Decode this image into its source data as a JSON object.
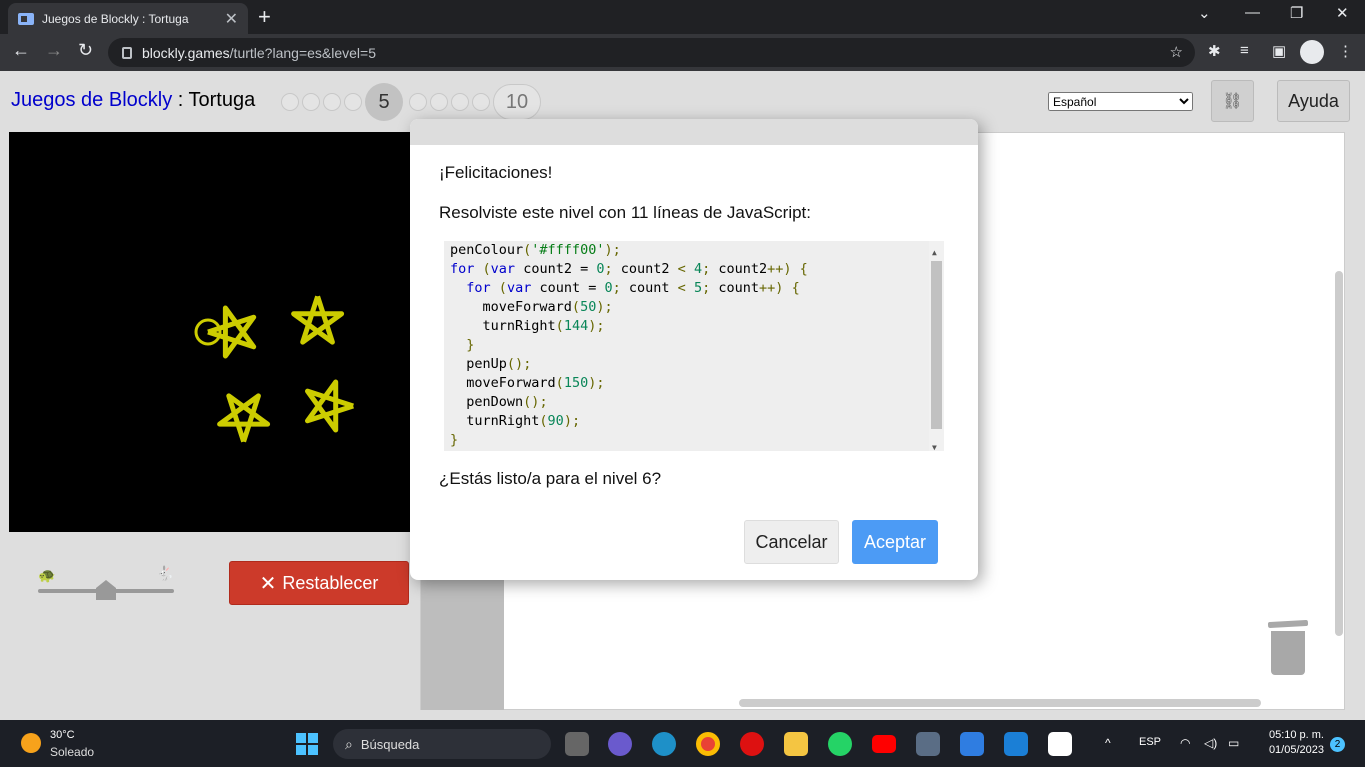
{
  "browser": {
    "tab_title": "Juegos de Blockly : Tortuga",
    "tab_close": "✕",
    "new_tab": "+",
    "url_host": "blockly.games",
    "url_path": "/turtle?lang=es&level=5"
  },
  "header": {
    "app_link": "Juegos de Blockly",
    "separator": " : ",
    "page": "Tortuga",
    "current_level": "5",
    "max_level": "10",
    "language": "Español",
    "help_label": "Ayuda",
    "link_icon": "link-icon"
  },
  "controls": {
    "reset_label": "Restablecer",
    "speed_level": 0.5
  },
  "dialog": {
    "congrats": "¡Felicitaciones!",
    "summary": "Resolviste este nivel con 11 líneas de JavaScript:",
    "code_lines": [
      "penColour('#ffff00');",
      "for (var count2 = 0; count2 < 4; count2++) {",
      "  for (var count = 0; count < 5; count++) {",
      "    moveForward(50);",
      "    turnRight(144);",
      "  }",
      "  penUp();",
      "  moveForward(150);",
      "  penDown();",
      "  turnRight(90);",
      "}"
    ],
    "question": "¿Estás listo/a para el nivel 6?",
    "cancel_label": "Cancelar",
    "ok_label": "Aceptar"
  },
  "taskbar": {
    "temperature": "30°C",
    "weather": "Soleado",
    "search_placeholder": "Búsqueda",
    "input_lang": "ESP",
    "time": "05:10 p. m.",
    "date": "01/05/2023",
    "notifications": "2"
  },
  "colors": {
    "pen": "#ffff00",
    "reset": "#cc3a2a",
    "accept": "#4c9bf5"
  }
}
